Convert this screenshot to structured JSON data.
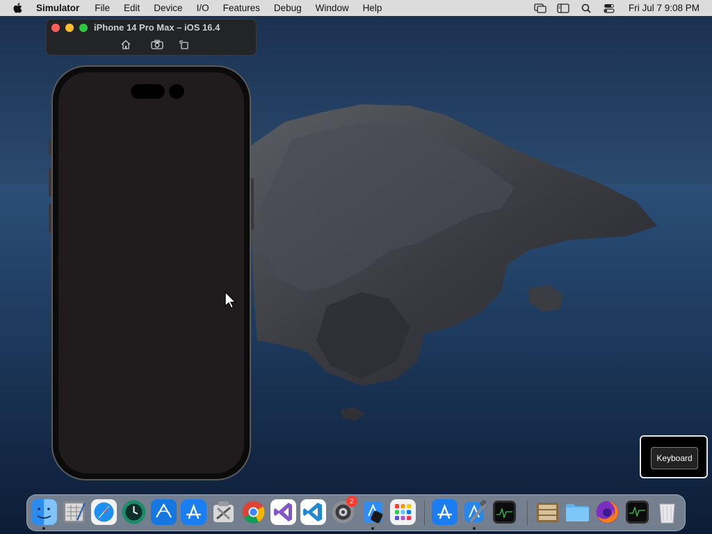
{
  "menubar": {
    "app_name": "Simulator",
    "items": [
      "File",
      "Edit",
      "Device",
      "I/O",
      "Features",
      "Debug",
      "Window",
      "Help"
    ],
    "clock": "Fri Jul 7  9:08 PM",
    "status_icons": [
      "screen-mirror-icon",
      "sidebar-icon",
      "search-icon",
      "control-center-icon"
    ]
  },
  "simulator": {
    "title": "iPhone 14 Pro Max – iOS 16.4",
    "toolbar_buttons": [
      "home-icon",
      "screenshot-icon",
      "rotate-icon"
    ]
  },
  "keyboard_overlay": {
    "label": "Keyboard"
  },
  "dock": {
    "apps": [
      {
        "icon": "finder-icon",
        "running": true
      },
      {
        "icon": "script-editor-icon",
        "running": false
      },
      {
        "icon": "safari-icon",
        "running": false
      },
      {
        "icon": "time-machine-icon",
        "running": false
      },
      {
        "icon": "instruments-icon",
        "running": false
      },
      {
        "icon": "app-store-icon",
        "running": false
      },
      {
        "icon": "system-toolkit-icon",
        "running": false
      },
      {
        "icon": "chrome-icon",
        "running": false
      },
      {
        "icon": "visual-studio-icon",
        "running": false
      },
      {
        "icon": "vscode-icon",
        "running": false
      },
      {
        "icon": "system-preferences-icon",
        "running": false,
        "badge": "2"
      },
      {
        "icon": "simulator-icon",
        "running": true
      },
      {
        "icon": "launchpad-icon",
        "running": false
      },
      {
        "icon": "app-store-icon",
        "running": false
      },
      {
        "icon": "xcode-icon",
        "running": true
      },
      {
        "icon": "activity-monitor-icon",
        "running": false
      },
      {
        "icon": "archive-icon",
        "running": false
      },
      {
        "icon": "folder-icon",
        "running": false
      },
      {
        "icon": "firefox-icon",
        "running": false
      },
      {
        "icon": "activity-monitor-icon",
        "running": false
      },
      {
        "icon": "trash-icon",
        "running": false
      }
    ]
  },
  "colors": {
    "menubar_bg": "#dcdcdc",
    "phone_screen": "#201c1d",
    "ocean": "#1b355a",
    "close": "#fe5f57",
    "minimize": "#febc2e",
    "maximize": "#28c840"
  }
}
